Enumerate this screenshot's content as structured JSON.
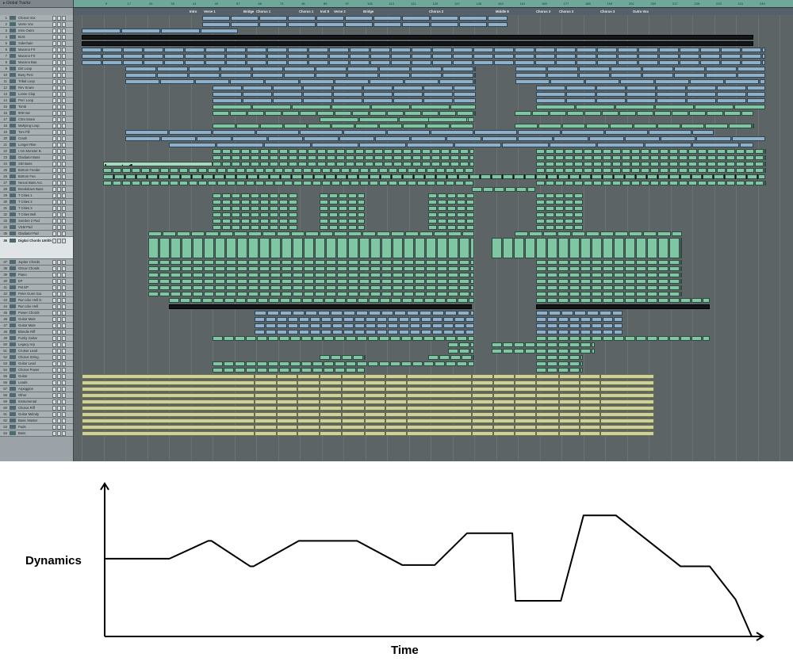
{
  "global_tracks_label": "Global Tracks",
  "ruler_ticks": [
    "9",
    "17",
    "25",
    "33",
    "41",
    "49",
    "57",
    "65",
    "73",
    "81",
    "89",
    "97",
    "105",
    "113",
    "121",
    "129",
    "137",
    "145",
    "153",
    "161",
    "169",
    "177",
    "185",
    "193",
    "201",
    "209",
    "217",
    "225",
    "233",
    "241",
    "249"
  ],
  "markers": [
    "Intro",
    "Verse 1",
    "Bridge",
    "Chorus 1",
    "Chorus 1",
    "Inst 8",
    "Verse 2",
    "Bridge",
    "Chorus 2",
    "Middle 8",
    "Chorus 3",
    "Chorus 3",
    "Chorus 3",
    "Outro Vox"
  ],
  "tracks": [
    "Chorus Vox",
    "Verse Vox",
    "Intro Outro",
    "BUS",
    "Sidechain",
    "Macono FX",
    "Macono FX",
    "Macono Bas.",
    "Dirt Loop",
    "Busy Perc",
    "Tribal Loop",
    "Rev Snare",
    "Loose Clap",
    "Perc Loop",
    "Tomb",
    "909 Hat",
    "Citra Snare",
    "Mahjong Loop",
    "Tom Fill",
    "Crash",
    "Longer Rise",
    "I Am Monster B.",
    "Gladiator Bass",
    "SID Bass",
    "Bottom Feeder",
    "Bottom Fee.",
    "Nexus Bass Acc.",
    "Breakdown Bass",
    "T Cities 1",
    "T Cities 2",
    "T Cities 3",
    "T Cities Bell",
    "Sombre 2 Pad",
    "VSM Pad",
    "Gladiator Pad",
    "Digital Chords Untitled",
    "Jupiter Chords",
    "OScar Chords",
    "Piano",
    "EP",
    "FM EP",
    "Peter Gunn Gui.",
    "Run Like Hell G.",
    "Run Like Hell",
    "Power Chords",
    "Guitar Mute",
    "Guitar Mute",
    "Blondie Riff",
    "Funky Guitar",
    "Legacy Arp",
    "Cruiser Lead",
    "Chorus String.",
    "Guitar Lead",
    "Chorus Power",
    "Guitar",
    "Leads",
    "Arpeggios",
    "Other",
    "Instrumental",
    "Chorus Riff",
    "Guitar Melody",
    "Basic Master",
    "Pads",
    "Bass"
  ],
  "selected_track": "Digital Chords Untitled",
  "region_labels": [
    "Rev",
    "Dist",
    "Inst 3",
    "Inst 12",
    "Inst 17",
    "Chorus",
    "Gladiator",
    "Leads",
    "Arpeggios",
    "Other",
    "Guitar Melody",
    "Output 1-2",
    "#default",
    "Bass"
  ],
  "graph": {
    "y_label": "Dynamics",
    "x_label": "Time"
  },
  "chart_data": {
    "type": "line",
    "title": "",
    "xlabel": "Time",
    "ylabel": "Dynamics",
    "x": [
      0,
      10,
      16,
      16.5,
      22.5,
      23,
      30,
      39,
      46,
      51,
      56,
      63,
      63.5,
      70.5,
      74,
      79,
      89,
      93.5,
      97.5,
      100
    ],
    "values": [
      0,
      61,
      61,
      75,
      75,
      55,
      55,
      75,
      75,
      56,
      56,
      81,
      81,
      28,
      28,
      95,
      95,
      55,
      55,
      29,
      0
    ],
    "xlim": [
      0,
      100
    ],
    "ylim": [
      0,
      120
    ],
    "grid": false,
    "ticks": false
  },
  "colors": {
    "region_green": "#7fc7a3",
    "region_blue": "#8fb0c6",
    "region_olive": "#cdd29b",
    "ruler": "#6fa79a",
    "background": "#5c6466"
  }
}
